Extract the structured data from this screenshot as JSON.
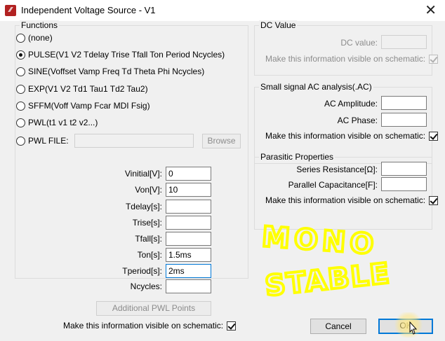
{
  "window": {
    "icon": "ltspice-icon",
    "title": "Independent Voltage Source - V1",
    "close_glyph": "✕"
  },
  "functions": {
    "title": "Functions",
    "options": [
      {
        "label": "(none)",
        "selected": false
      },
      {
        "label": "PULSE(V1 V2 Tdelay Trise Tfall Ton Period Ncycles)",
        "selected": true
      },
      {
        "label": "SINE(Voffset Vamp Freq Td Theta Phi Ncycles)",
        "selected": false
      },
      {
        "label": "EXP(V1 V2 Td1 Tau1 Td2 Tau2)",
        "selected": false
      },
      {
        "label": "SFFM(Voff Vamp Fcar MDI Fsig)",
        "selected": false
      },
      {
        "label": "PWL(t1 v1 t2 v2...)",
        "selected": false
      },
      {
        "label": "PWL FILE:",
        "selected": false
      }
    ],
    "pwl_file_value": "",
    "browse_label": "Browse",
    "params": [
      {
        "label": "Vinitial[V]:",
        "value": "0"
      },
      {
        "label": "Von[V]:",
        "value": "10"
      },
      {
        "label": "Tdelay[s]:",
        "value": ""
      },
      {
        "label": "Trise[s]:",
        "value": ""
      },
      {
        "label": "Tfall[s]:",
        "value": ""
      },
      {
        "label": "Ton[s]:",
        "value": "1.5ms"
      },
      {
        "label": "Tperiod[s]:",
        "value": "2ms"
      },
      {
        "label": "Ncycles:",
        "value": ""
      }
    ],
    "additional_pwl_label": "Additional PWL Points",
    "visible_on_schematic_label": "Make this information visible on schematic:",
    "visible_on_schematic_checked": true
  },
  "dc_value": {
    "title": "DC Value",
    "label": "DC value:",
    "value": "",
    "visible_label": "Make this information visible on schematic:",
    "visible_checked": true
  },
  "ac_analysis": {
    "title": "Small signal AC analysis(.AC)",
    "amplitude_label": "AC Amplitude:",
    "amplitude_value": "",
    "phase_label": "AC Phase:",
    "phase_value": "",
    "visible_label": "Make this information visible on schematic:",
    "visible_checked": true
  },
  "parasitic": {
    "title": "Parasitic Properties",
    "series_res_label": "Series Resistance[Ω]:",
    "series_res_value": "",
    "parallel_cap_label": "Parallel Capacitance[F]:",
    "parallel_cap_value": "",
    "visible_label": "Make this information visible on schematic:",
    "visible_checked": true
  },
  "annotation": {
    "line1": "MONO",
    "line2": "STABLE",
    "color": "#ffff00"
  },
  "buttons": {
    "cancel": "Cancel",
    "ok": "OK"
  }
}
